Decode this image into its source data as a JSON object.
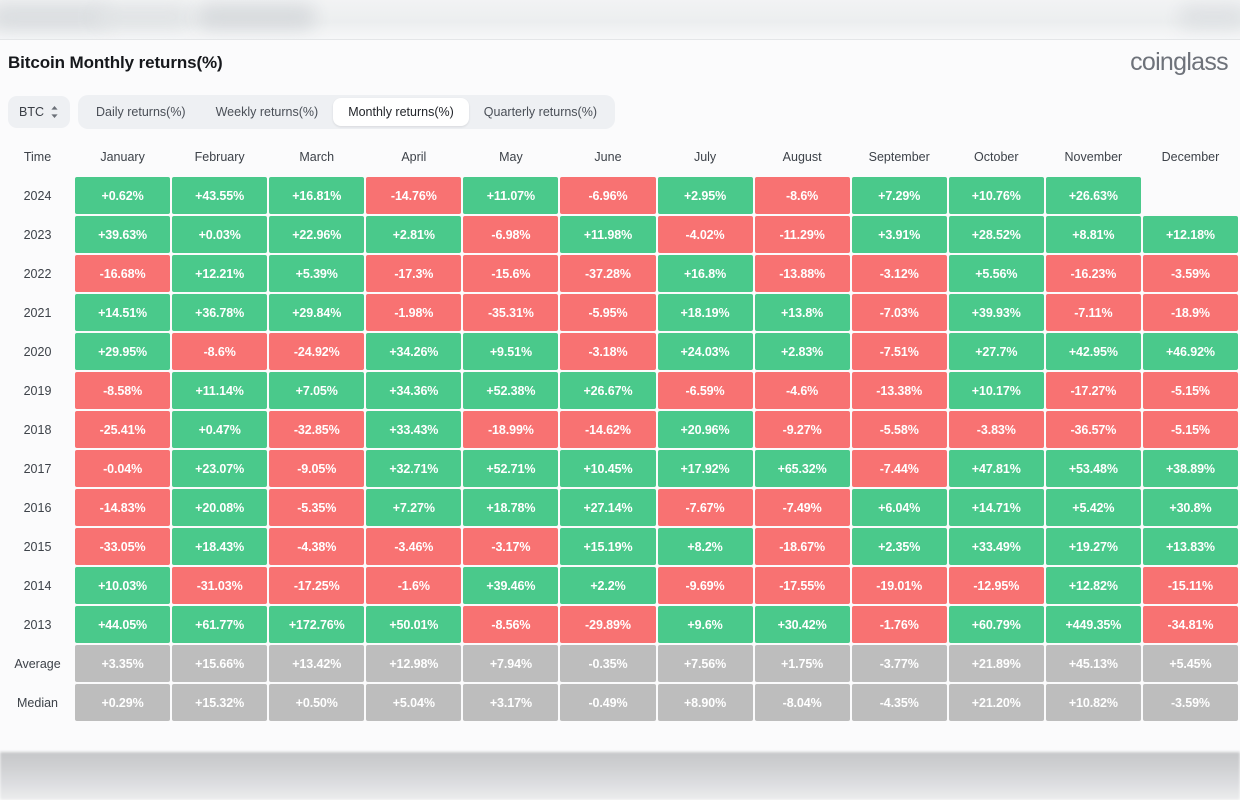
{
  "browser": {
    "chrome_blurred": true
  },
  "header": {
    "title": "Bitcoin Monthly returns(%)",
    "brand": "coinglass"
  },
  "controls": {
    "coin_selector": {
      "label": "BTC",
      "icon": "chevron-up-down-icon"
    },
    "tabs": [
      {
        "label": "Daily returns(%)",
        "active": false
      },
      {
        "label": "Weekly returns(%)",
        "active": false
      },
      {
        "label": "Monthly returns(%)",
        "active": true
      },
      {
        "label": "Quarterly returns(%)",
        "active": false
      }
    ]
  },
  "colors": {
    "positive": "#4ac98b",
    "negative": "#f87272",
    "statistic": "#bdbdbd",
    "tab_active_bg": "#ffffff",
    "tab_bar_bg": "#eef0f3",
    "card_bg": "#fbfbfc"
  },
  "chart_data": {
    "type": "heatmap",
    "title": "Bitcoin Monthly returns(%)",
    "xlabel": "",
    "ylabel": "Time",
    "grid": true,
    "legend": "none",
    "columns": [
      "Time",
      "January",
      "February",
      "March",
      "April",
      "May",
      "June",
      "July",
      "August",
      "September",
      "October",
      "November",
      "December"
    ],
    "categories": [
      "January",
      "February",
      "March",
      "April",
      "May",
      "June",
      "July",
      "August",
      "September",
      "October",
      "November",
      "December"
    ],
    "rows": [
      {
        "label": "2024",
        "kind": "year",
        "values": [
          "+0.62%",
          "+43.55%",
          "+16.81%",
          "-14.76%",
          "+11.07%",
          "-6.96%",
          "+2.95%",
          "-8.6%",
          "+7.29%",
          "+10.76%",
          "+26.63%",
          ""
        ]
      },
      {
        "label": "2023",
        "kind": "year",
        "values": [
          "+39.63%",
          "+0.03%",
          "+22.96%",
          "+2.81%",
          "-6.98%",
          "+11.98%",
          "-4.02%",
          "-11.29%",
          "+3.91%",
          "+28.52%",
          "+8.81%",
          "+12.18%"
        ]
      },
      {
        "label": "2022",
        "kind": "year",
        "values": [
          "-16.68%",
          "+12.21%",
          "+5.39%",
          "-17.3%",
          "-15.6%",
          "-37.28%",
          "+16.8%",
          "-13.88%",
          "-3.12%",
          "+5.56%",
          "-16.23%",
          "-3.59%"
        ]
      },
      {
        "label": "2021",
        "kind": "year",
        "values": [
          "+14.51%",
          "+36.78%",
          "+29.84%",
          "-1.98%",
          "-35.31%",
          "-5.95%",
          "+18.19%",
          "+13.8%",
          "-7.03%",
          "+39.93%",
          "-7.11%",
          "-18.9%"
        ]
      },
      {
        "label": "2020",
        "kind": "year",
        "values": [
          "+29.95%",
          "-8.6%",
          "-24.92%",
          "+34.26%",
          "+9.51%",
          "-3.18%",
          "+24.03%",
          "+2.83%",
          "-7.51%",
          "+27.7%",
          "+42.95%",
          "+46.92%"
        ]
      },
      {
        "label": "2019",
        "kind": "year",
        "values": [
          "-8.58%",
          "+11.14%",
          "+7.05%",
          "+34.36%",
          "+52.38%",
          "+26.67%",
          "-6.59%",
          "-4.6%",
          "-13.38%",
          "+10.17%",
          "-17.27%",
          "-5.15%"
        ]
      },
      {
        "label": "2018",
        "kind": "year",
        "values": [
          "-25.41%",
          "+0.47%",
          "-32.85%",
          "+33.43%",
          "-18.99%",
          "-14.62%",
          "+20.96%",
          "-9.27%",
          "-5.58%",
          "-3.83%",
          "-36.57%",
          "-5.15%"
        ]
      },
      {
        "label": "2017",
        "kind": "year",
        "values": [
          "-0.04%",
          "+23.07%",
          "-9.05%",
          "+32.71%",
          "+52.71%",
          "+10.45%",
          "+17.92%",
          "+65.32%",
          "-7.44%",
          "+47.81%",
          "+53.48%",
          "+38.89%"
        ]
      },
      {
        "label": "2016",
        "kind": "year",
        "values": [
          "-14.83%",
          "+20.08%",
          "-5.35%",
          "+7.27%",
          "+18.78%",
          "+27.14%",
          "-7.67%",
          "-7.49%",
          "+6.04%",
          "+14.71%",
          "+5.42%",
          "+30.8%"
        ]
      },
      {
        "label": "2015",
        "kind": "year",
        "values": [
          "-33.05%",
          "+18.43%",
          "-4.38%",
          "-3.46%",
          "-3.17%",
          "+15.19%",
          "+8.2%",
          "-18.67%",
          "+2.35%",
          "+33.49%",
          "+19.27%",
          "+13.83%"
        ]
      },
      {
        "label": "2014",
        "kind": "year",
        "values": [
          "+10.03%",
          "-31.03%",
          "-17.25%",
          "-1.6%",
          "+39.46%",
          "+2.2%",
          "-9.69%",
          "-17.55%",
          "-19.01%",
          "-12.95%",
          "+12.82%",
          "-15.11%"
        ]
      },
      {
        "label": "2013",
        "kind": "year",
        "values": [
          "+44.05%",
          "+61.77%",
          "+172.76%",
          "+50.01%",
          "-8.56%",
          "-29.89%",
          "+9.6%",
          "+30.42%",
          "-1.76%",
          "+60.79%",
          "+449.35%",
          "-34.81%"
        ]
      },
      {
        "label": "Average",
        "kind": "stat",
        "values": [
          "+3.35%",
          "+15.66%",
          "+13.42%",
          "+12.98%",
          "+7.94%",
          "-0.35%",
          "+7.56%",
          "+1.75%",
          "-3.77%",
          "+21.89%",
          "+45.13%",
          "+5.45%"
        ]
      },
      {
        "label": "Median",
        "kind": "stat",
        "values": [
          "+0.29%",
          "+15.32%",
          "+0.50%",
          "+5.04%",
          "+3.17%",
          "-0.49%",
          "+8.90%",
          "-8.04%",
          "-4.35%",
          "+21.20%",
          "+10.82%",
          "-3.59%"
        ]
      }
    ]
  }
}
